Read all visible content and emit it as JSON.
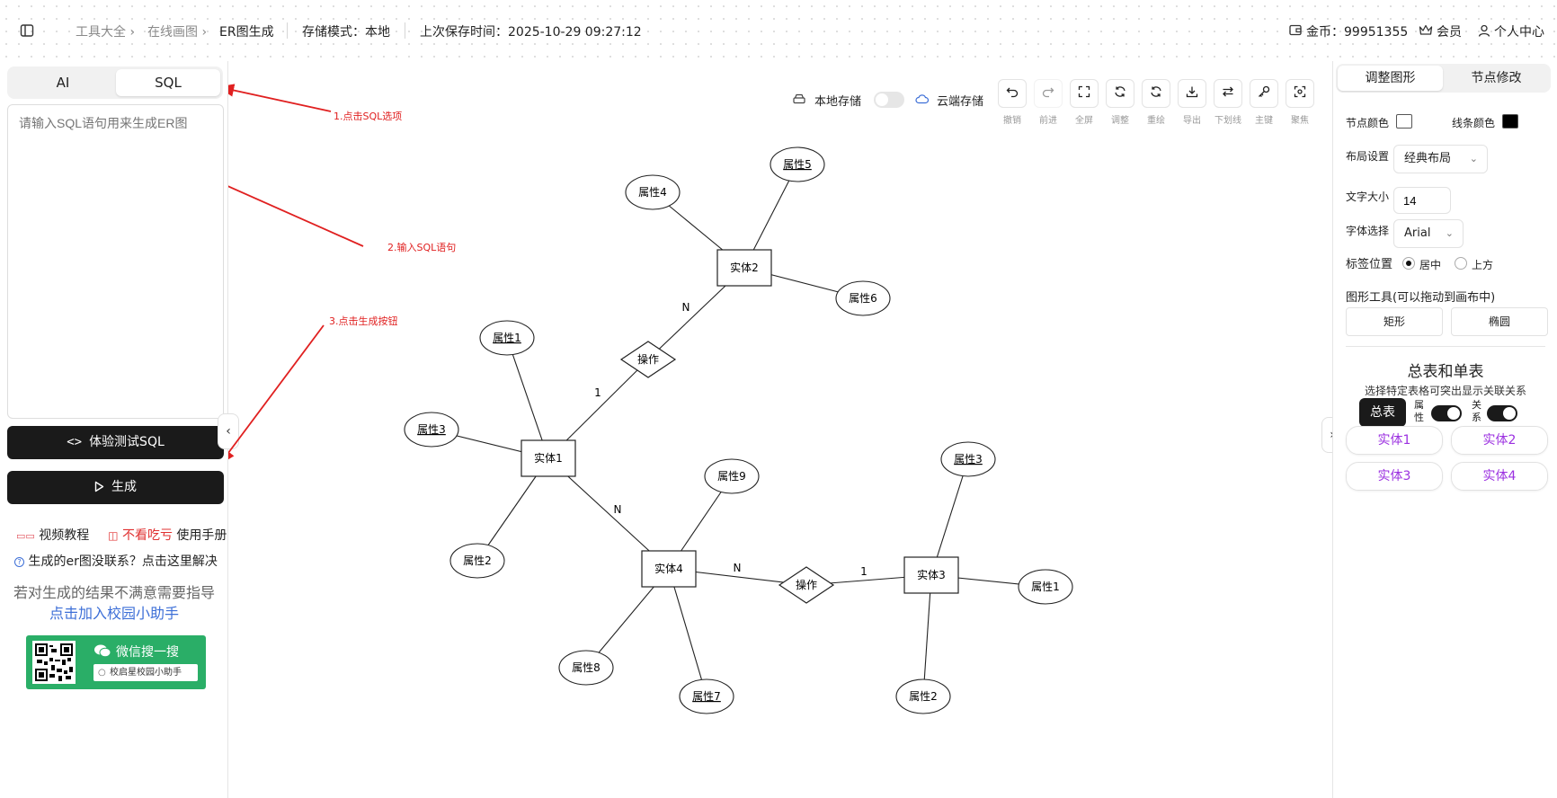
{
  "topbar": {
    "breadcrumb_tools": "工具大全",
    "breadcrumb_draw": "在线画图",
    "breadcrumb_current": "ER图生成",
    "storage_mode_label": "存储模式：本地",
    "last_saved": "上次保存时间：2025-10-29 09:27:12",
    "coins": "金币：99951355",
    "vip": "会员",
    "user_center": "个人中心"
  },
  "left": {
    "tabs": [
      "AI",
      "SQL"
    ],
    "active_tab": "SQL",
    "sql_placeholder": "请输入SQL语句用来生成ER图",
    "try_sql_label": "体验测试SQL",
    "generate_label": "生成",
    "video_tutorial": "视频教程",
    "dont_miss": "不看吃亏",
    "manual": "使用手册",
    "faq": "生成的er图没联系？点击这里解决",
    "help_text": "若对生成的结果不满意需要指导",
    "help_link": "点击加入校园小助手",
    "wechat_title": "微信搜一搜",
    "wechat_search": "校启星校园小助手"
  },
  "annotations": {
    "step1": "1.点击SQL选项",
    "step2": "2.输入SQL语句",
    "step3": "3.点击生成按钮"
  },
  "canvas": {
    "local_storage": "本地存储",
    "cloud_storage": "云端存储",
    "local_storage_enabled": false,
    "tools": [
      "撤销",
      "前进",
      "全屏",
      "调整",
      "重绘",
      "导出",
      "下划线",
      "主键",
      "聚焦"
    ],
    "er": {
      "entities": [
        "实体1",
        "实体2",
        "实体3",
        "实体4"
      ],
      "relations": [
        "操作",
        "操作"
      ],
      "attributes": {
        "e1": [
          "属性1",
          "属性3",
          "属性2"
        ],
        "e2": [
          "属性4",
          "属性5",
          "属性6"
        ],
        "e3": [
          "属性3",
          "属性1",
          "属性2"
        ],
        "e4": [
          "属性9",
          "属性8",
          "属性7"
        ]
      },
      "cardinality": [
        "N",
        "1",
        "N",
        "N",
        "1"
      ]
    }
  },
  "right": {
    "tabs": [
      "调整图形",
      "节点修改"
    ],
    "active_tab": "调整图形",
    "node_color_label": "节点颜色",
    "line_color_label": "线条颜色",
    "node_color": "#ffffff",
    "line_color": "#000000",
    "layout_label": "布局设置",
    "layout_value": "经典布局",
    "font_size_label": "文字大小",
    "font_size_value": "14",
    "font_label": "字体选择",
    "font_value": "Arial",
    "label_pos_label": "标签位置",
    "label_pos_center": "居中",
    "label_pos_top": "上方",
    "shape_tools_label": "图形工具(可以拖动到画布中)",
    "rect_label": "矩形",
    "ellipse_label": "椭圆",
    "summary_title": "总表和单表",
    "summary_desc": "选择特定表格可突出显示关联关系",
    "total_label": "总表",
    "attr_toggle_label": "属性",
    "rel_toggle_label": "关系",
    "attr_on": true,
    "rel_on": true,
    "entity_buttons": [
      "实体1",
      "实体2",
      "实体3",
      "实体4"
    ]
  }
}
